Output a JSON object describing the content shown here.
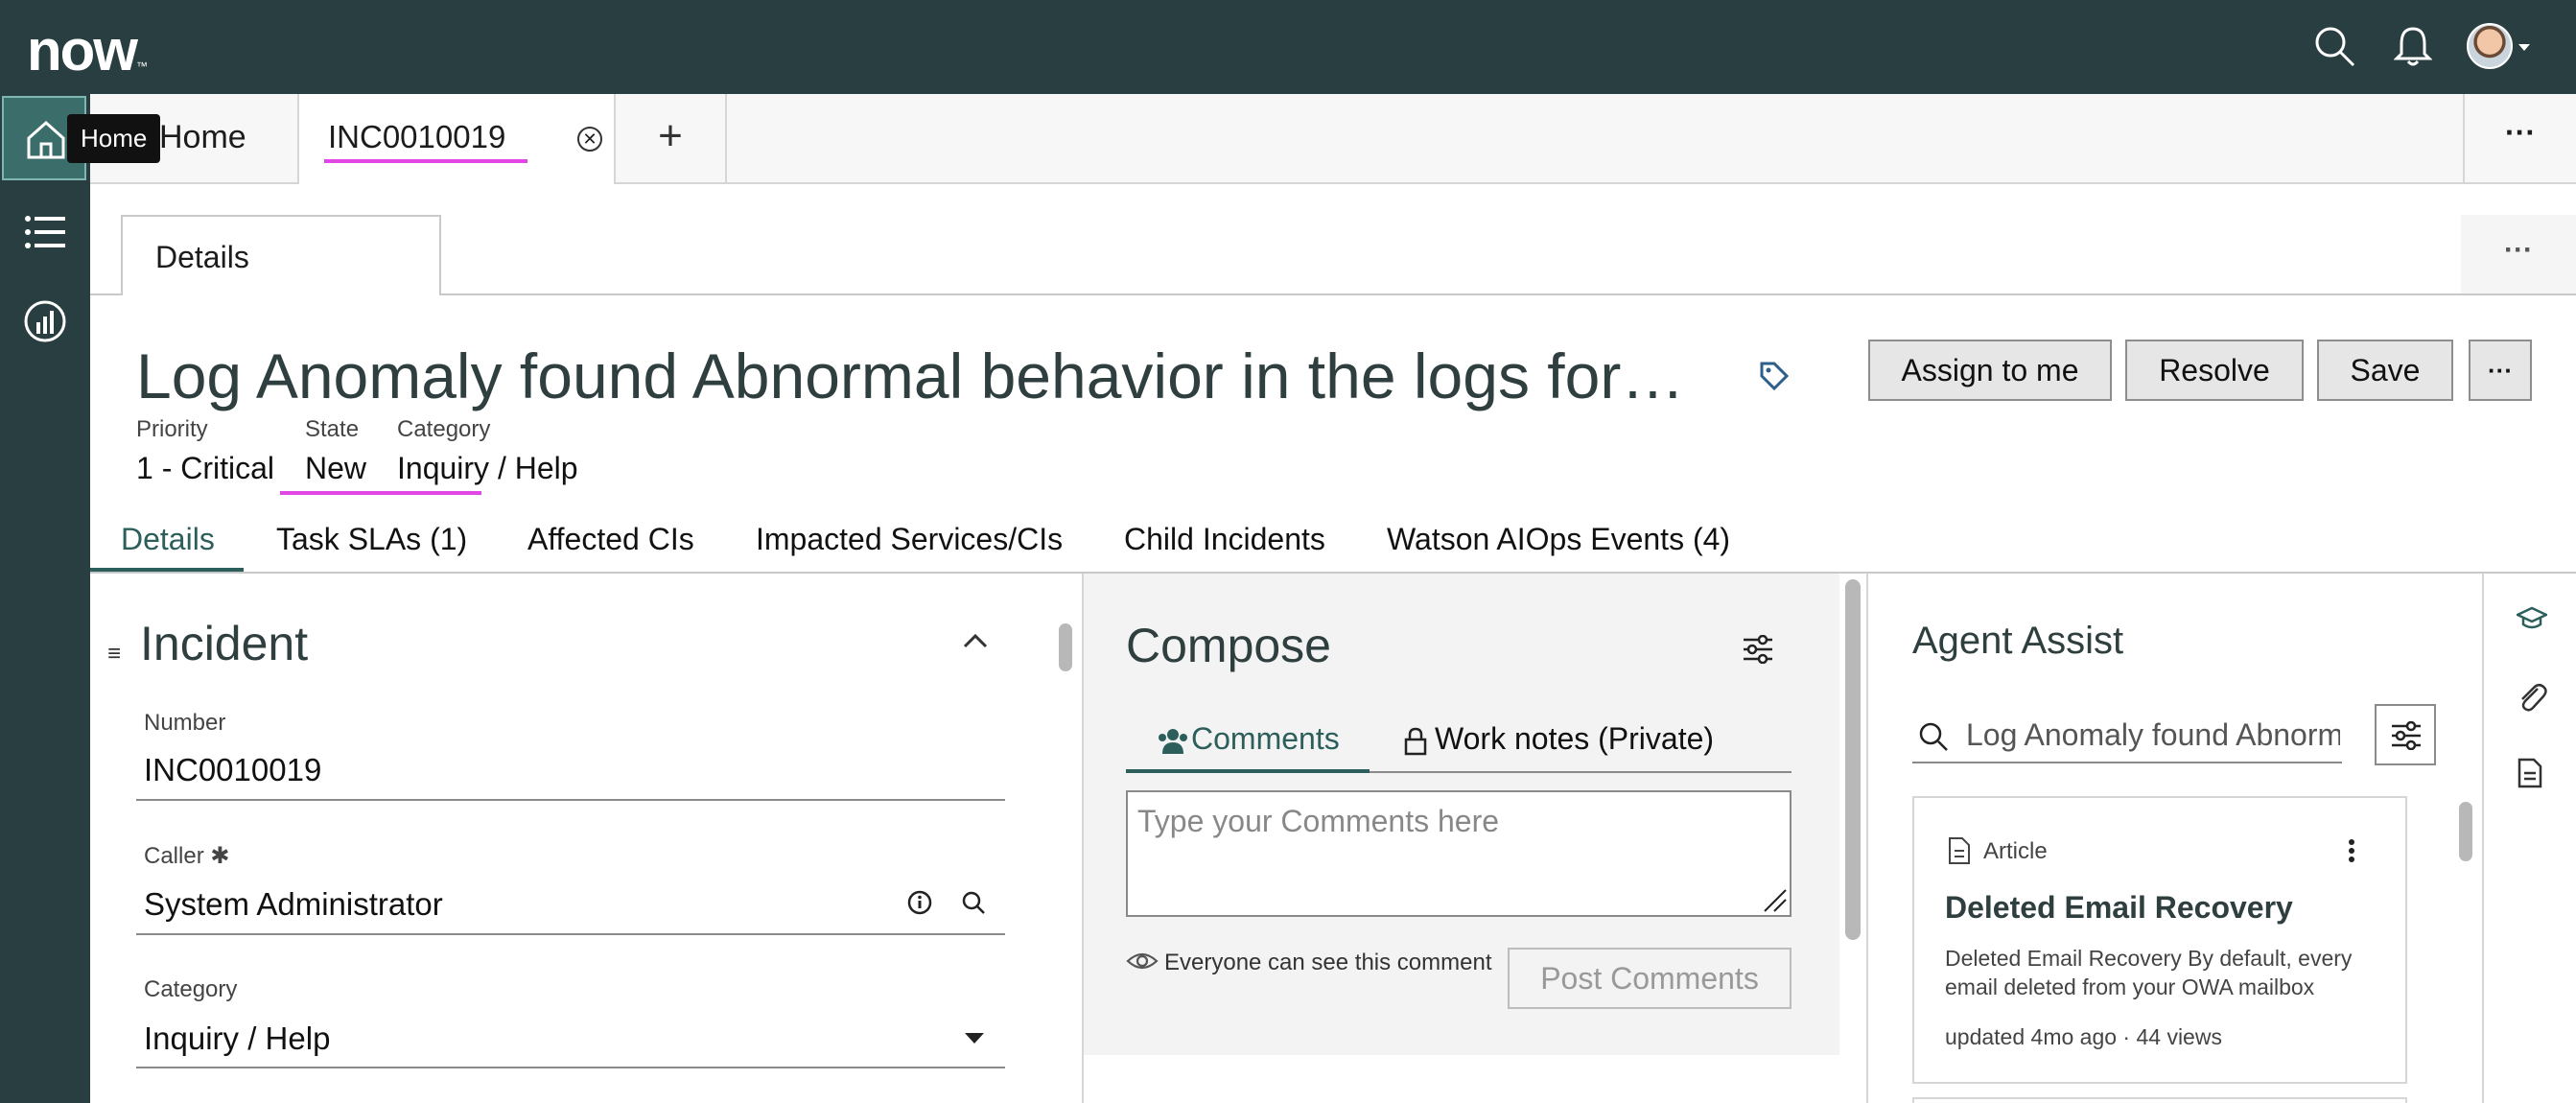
{
  "header": {
    "logo": "now",
    "logo_tm": "™"
  },
  "nav": {
    "home_tooltip": "Home"
  },
  "tabs": {
    "home_label": "Home",
    "incident_label": "INC0010019",
    "close_glyph": "✕",
    "add_glyph": "+",
    "more_glyph": "···"
  },
  "page": {
    "details_tab": "Details",
    "more_glyph": "···"
  },
  "record": {
    "title": "Log Anomaly found Abnormal behavior in the logs for c…",
    "priority_label": "Priority",
    "priority_value": "1 - Critical",
    "state_label": "State",
    "state_value": "New",
    "category_label": "Category",
    "category_value": "Inquiry / Help"
  },
  "actions": {
    "assign": "Assign to me",
    "resolve": "Resolve",
    "save": "Save",
    "more": "···"
  },
  "subtabs": [
    "Details",
    "Task SLAs (1)",
    "Affected CIs",
    "Impacted Services/CIs",
    "Child Incidents",
    "Watson AIOps Events (4)"
  ],
  "incident_form": {
    "section_title": "Incident",
    "drag_glyph": "≡",
    "number_label": "Number",
    "number_value": "INC0010019",
    "caller_label": "Caller ✱",
    "caller_value": "System Administrator",
    "category_label": "Category",
    "category_value": "Inquiry / Help"
  },
  "compose": {
    "title": "Compose",
    "comments_tab": "Comments",
    "worknotes_tab": "Work notes (Private)",
    "placeholder": "Type your Comments here",
    "visibility": "Everyone can see this comment",
    "post_button": "Post Comments"
  },
  "agent_assist": {
    "title": "Agent Assist",
    "search_value": "Log Anomaly found Abnorm",
    "card_type": "Article",
    "card_title": "Deleted Email Recovery",
    "card_desc": "Deleted Email Recovery By default, every email deleted from your OWA mailbox",
    "card_meta": "updated 4mo ago · 44 views"
  },
  "colors": {
    "topbar": "#293e40",
    "accent": "#2c5f5b",
    "highlight": "#e047e3"
  }
}
